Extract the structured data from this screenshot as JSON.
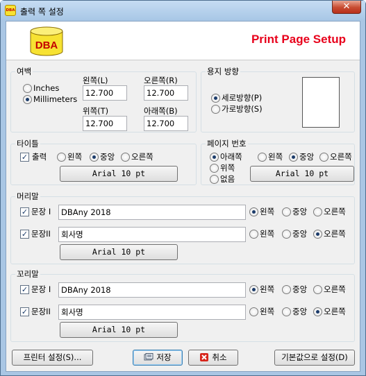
{
  "window": {
    "title": "출력 쪽 설정",
    "close_symbol": "✕",
    "icon_text": "DBA"
  },
  "banner": {
    "logo_text": "DBA",
    "title": "Print Page Setup"
  },
  "margins": {
    "label": "여백",
    "units": [
      {
        "label": "Inches",
        "selected": false
      },
      {
        "label": "Millimeters",
        "selected": true
      }
    ],
    "left_label": "왼쪽(L)",
    "left_value": "12.700",
    "right_label": "오른쪽(R)",
    "right_value": "12.700",
    "top_label": "위쪽(T)",
    "top_value": "12.700",
    "bottom_label": "아래쪽(B)",
    "bottom_value": "12.700"
  },
  "orientation": {
    "label": "용지 방향",
    "portrait_label": "세로방향(P)",
    "portrait_selected": true,
    "landscape_label": "가로방향(S)",
    "landscape_selected": false
  },
  "title_section": {
    "label": "타이틀",
    "print_label": "출력",
    "print_checked": true,
    "align_left": "왼쪽",
    "align_center": "중앙",
    "align_right": "오른쪽",
    "selected": "center",
    "font_button": "Arial 10 pt"
  },
  "page_number": {
    "label": "페이지 번호",
    "pos_bottom": "아래쪽",
    "pos_top": "위쪽",
    "pos_none": "없음",
    "position_selected": "bottom",
    "align_left": "왼쪽",
    "align_center": "중앙",
    "align_right": "오른쪽",
    "selected": "center",
    "font_button": "Arial 10 pt"
  },
  "header": {
    "label": "머리말",
    "line1_label": "문장 I",
    "line1_checked": true,
    "line1_value": "DBAny 2018",
    "line1_align": "left",
    "line2_label": "문장II",
    "line2_checked": true,
    "line2_value": "회사명",
    "line2_align": "right",
    "align_left": "왼쪽",
    "align_center": "중앙",
    "align_right": "오른쪽",
    "font_button": "Arial 10 pt"
  },
  "footer": {
    "label": "꼬리말",
    "line1_label": "문장 I",
    "line1_checked": true,
    "line1_value": "DBAny 2018",
    "line1_align": "left",
    "line2_label": "문장II",
    "line2_checked": true,
    "line2_value": "회사명",
    "line2_align": "right",
    "align_left": "왼쪽",
    "align_center": "중앙",
    "align_right": "오른쪽",
    "font_button": "Arial 10 pt"
  },
  "buttons": {
    "printer_setup": "프린터 설정(S)...",
    "save": "저장",
    "cancel": "취소",
    "default": "기본값으로 설정(D)"
  },
  "colors": {
    "banner_title": "#e8001b",
    "logo_fill": "#f7e232",
    "logo_text": "#c40000"
  }
}
